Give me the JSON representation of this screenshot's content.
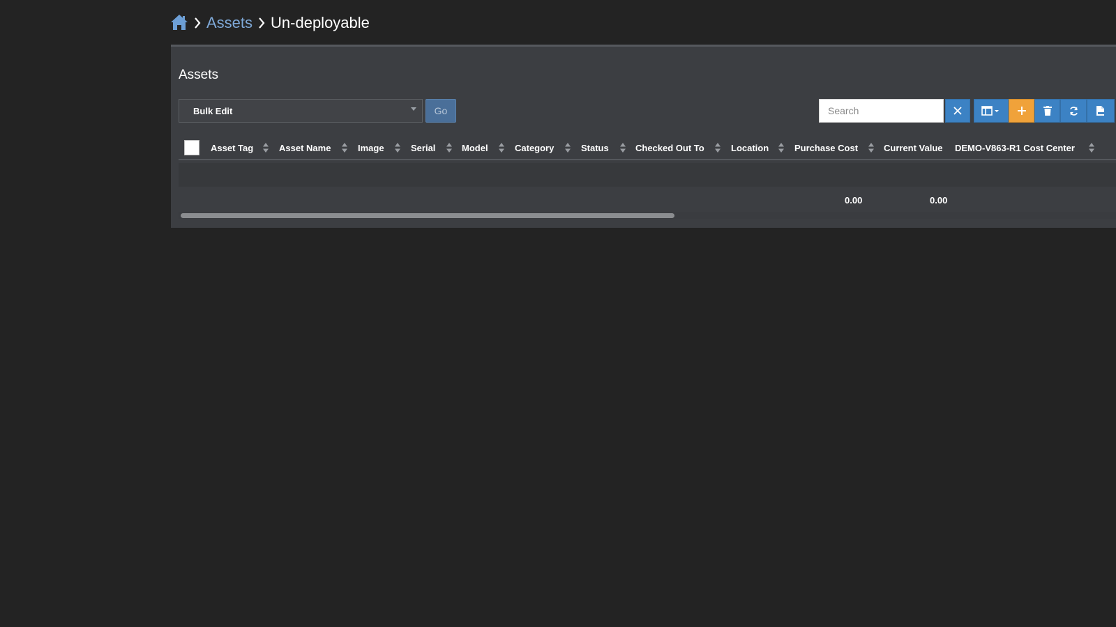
{
  "breadcrumb": {
    "home_icon": "home-icon",
    "items": [
      {
        "label": "Assets"
      },
      {
        "label": "Un-deployable"
      }
    ]
  },
  "panel": {
    "title": "Assets",
    "bulk": {
      "selected": "Bulk Edit",
      "go_label": "Go"
    },
    "search": {
      "placeholder": "Search"
    },
    "toolbar_icons": [
      "clear-search-icon",
      "columns-icon",
      "add-icon",
      "trash-icon",
      "refresh-icon",
      "export-icon"
    ],
    "columns": [
      "Asset Tag",
      "Asset Name",
      "Image",
      "Serial",
      "Model",
      "Category",
      "Status",
      "Checked Out To",
      "Location",
      "Purchase Cost",
      "Current Value",
      "DEMO-V863-R1 Cost Center"
    ],
    "footer": {
      "purchase_cost_total": "0.00",
      "current_value_total": "0.00"
    }
  },
  "colors": {
    "page_bg": "#232323",
    "panel_bg": "#3c3e42",
    "link": "#7fa9d8",
    "primary": "#3c82c4",
    "warning": "#f0a23a"
  }
}
